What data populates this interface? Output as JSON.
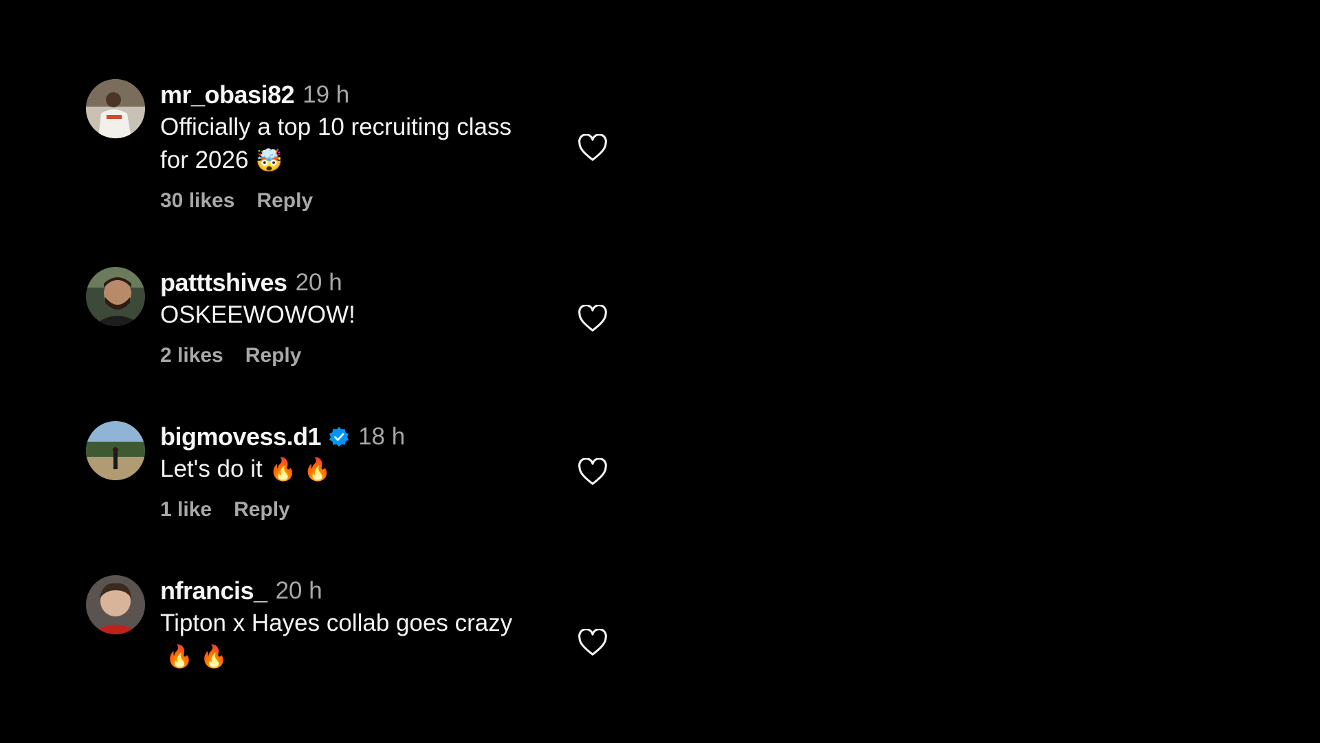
{
  "comments": [
    {
      "username": "mr_obasi82",
      "time": "19 h",
      "text_line1": "Officially a top 10 recruiting class",
      "text_line2": "for 2026",
      "emoji": "🤯",
      "likes": "30 likes",
      "reply": "Reply",
      "verified": false
    },
    {
      "username": "patttshives",
      "time": "20 h",
      "text": "OSKEEWOWOW!",
      "likes": "2 likes",
      "reply": "Reply",
      "verified": false
    },
    {
      "username": "bigmovess.d1",
      "time": "18 h",
      "text": "Let's do it",
      "emoji": "🔥 🔥",
      "likes": "1 like",
      "reply": "Reply",
      "verified": true
    },
    {
      "username": "nfrancis_",
      "time": "20 h",
      "text_line1": "Tipton x Hayes collab goes crazy",
      "emoji_line2": "🔥 🔥",
      "verified": false
    }
  ],
  "colors": {
    "background": "#000000",
    "primary_text": "#f5f5f5",
    "secondary_text": "#a8a8a8",
    "verified_badge": "#0095f6"
  },
  "icons": {
    "like": "heart-outline-icon",
    "verified": "verified-badge-icon"
  }
}
